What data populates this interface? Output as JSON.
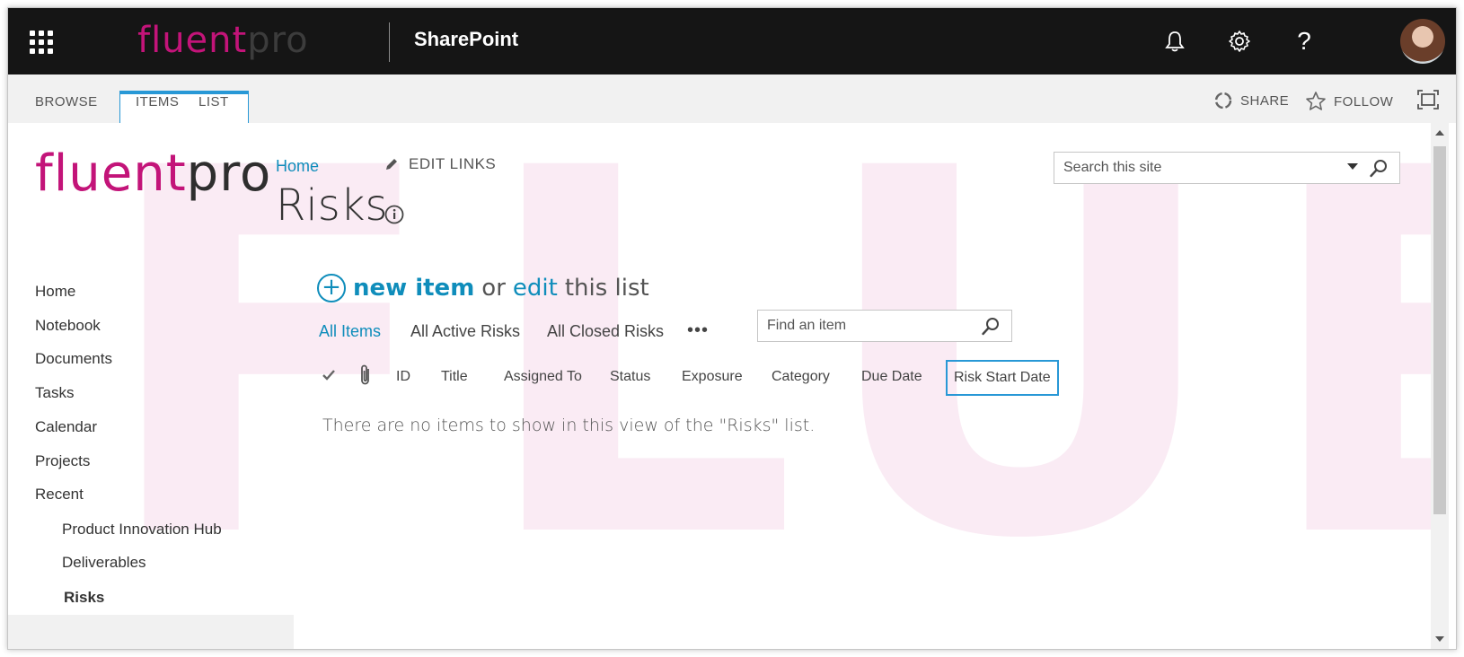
{
  "suite_bar": {
    "logo_part1": "fluent",
    "logo_part2": "pro",
    "app_title": "SharePoint",
    "icons": [
      "app-launcher-icon",
      "bell-icon",
      "gear-icon",
      "help-icon"
    ],
    "help_glyph": "?"
  },
  "ribbon": {
    "tabs": [
      {
        "label": "BROWSE"
      },
      {
        "label": "ITEMS"
      },
      {
        "label": "LIST"
      }
    ],
    "share_label": "SHARE",
    "follow_label": "FOLLOW"
  },
  "site": {
    "logo_part1": "fluent",
    "logo_part2": "pro",
    "top_nav_home": "Home",
    "edit_links": "EDIT LINKS",
    "page_title": "Risks",
    "search_placeholder": "Search this site"
  },
  "left_nav": {
    "items": [
      "Home",
      "Notebook",
      "Documents",
      "Tasks",
      "Calendar",
      "Projects",
      "Recent"
    ],
    "recent_items": [
      "Product Innovation Hub",
      "Deliverables",
      "Risks"
    ],
    "selected": "Risks"
  },
  "list": {
    "new_item": "new item",
    "or": "or",
    "edit": "edit",
    "this_list": "this list",
    "views": [
      "All Items",
      "All Active Risks",
      "All Closed Risks"
    ],
    "active_view": "All Items",
    "more": "•••",
    "find_placeholder": "Find an item",
    "columns": [
      "ID",
      "Title",
      "Assigned To",
      "Status",
      "Exposure",
      "Category",
      "Due Date",
      "Risk Start Date"
    ],
    "focused_column": "Risk Start Date",
    "empty_message": "There are no items to show in this view of the \"Risks\" list."
  },
  "colors": {
    "brand_magenta": "#c31479",
    "link_blue": "#0f8dbb",
    "focus_blue": "#2898d6",
    "suite_bar_bg": "#151515"
  }
}
